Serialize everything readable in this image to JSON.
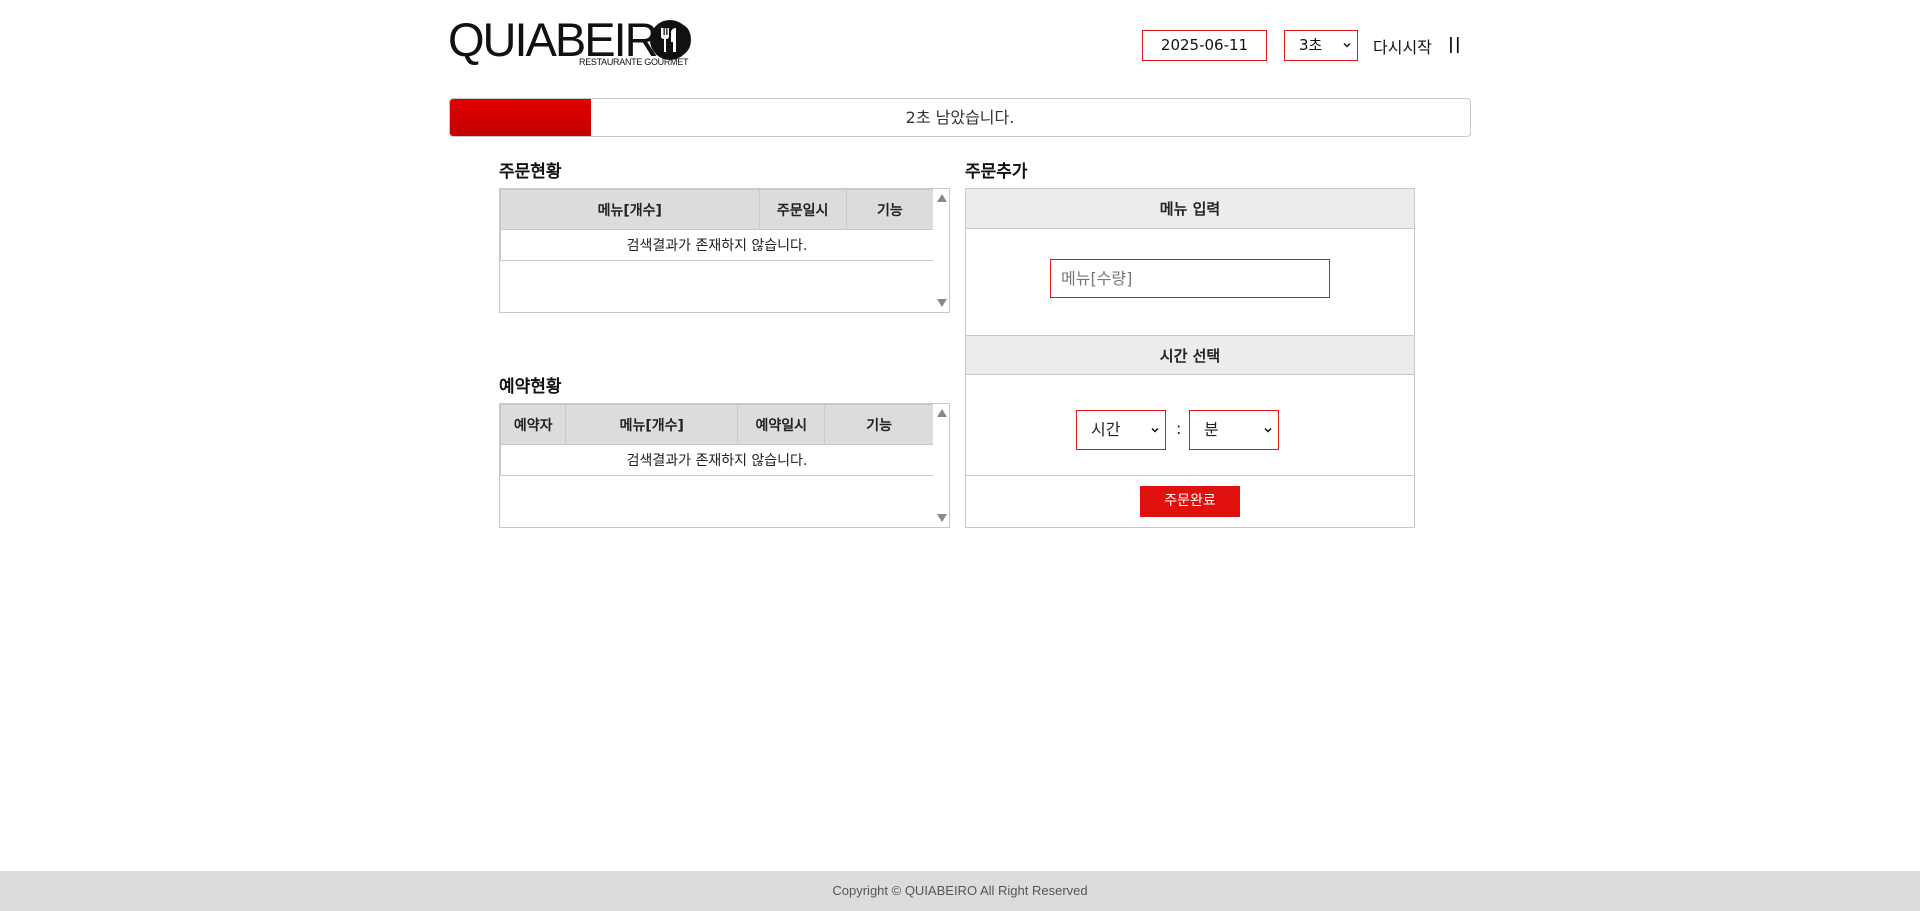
{
  "header": {
    "logo_text": "QUIABEIRO",
    "logo_subtitle": "RESTAURANTE GOURMET",
    "date_value": "2025-06-11",
    "interval_select": "3초",
    "restart_label": "다시시작",
    "pause_label": "||"
  },
  "progress": {
    "text": "2초 남았습니다.",
    "fraction": 0.138,
    "color": "#cc0000"
  },
  "orders": {
    "title": "주문현황",
    "columns": [
      "메뉴[개수]",
      "주문일시",
      "기능"
    ],
    "empty_message": "검색결과가 존재하지 않습니다."
  },
  "reservations": {
    "title": "예약현황",
    "columns": [
      "예약자",
      "메뉴[개수]",
      "예약일시",
      "기능"
    ],
    "empty_message": "검색결과가 존재하지 않습니다."
  },
  "add_order": {
    "title": "주문추가",
    "menu_section_label": "메뉴 입력",
    "menu_placeholder": "메뉴[수량]",
    "time_section_label": "시간 선택",
    "hour_select": "시간",
    "minute_select": "분",
    "separator": ":",
    "submit_label": "주문완료"
  },
  "footer": {
    "copyright": "Copyright © QUIABEIRO All Right Reserved"
  },
  "colors": {
    "accent": "#e0100f",
    "header_bg": "#dcdcdc",
    "footer_bg": "#dcdcdc"
  }
}
